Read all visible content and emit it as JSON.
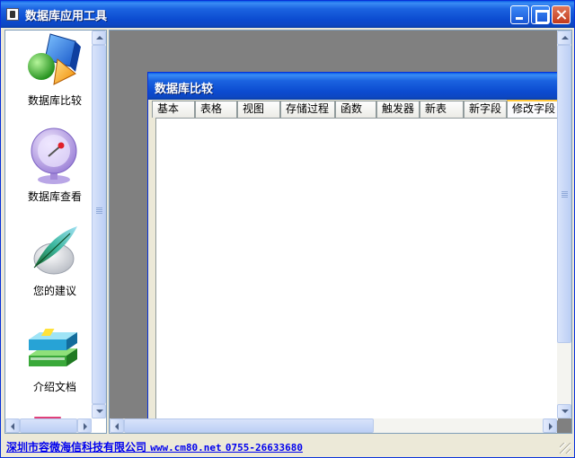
{
  "window": {
    "title": "数据库应用工具"
  },
  "sidebar": {
    "items": [
      {
        "label": "数据库比较",
        "icon": "shapes-icon"
      },
      {
        "label": "数据库查看",
        "icon": "satellite-dish-icon"
      },
      {
        "label": "您的建议",
        "icon": "feather-icon"
      },
      {
        "label": "介绍文档",
        "icon": "books-icon"
      }
    ]
  },
  "child_window": {
    "title": "数据库比较",
    "tabs": [
      "基本",
      "表格",
      "视图",
      "存储过程",
      "函数",
      "触发器",
      "新表",
      "新字段",
      "修改字段"
    ],
    "active_tab": "修改字段"
  },
  "status": {
    "company": "深圳市容微海信科技有限公司",
    "url": "www.cm80.net",
    "phone": "0755-26633680"
  }
}
